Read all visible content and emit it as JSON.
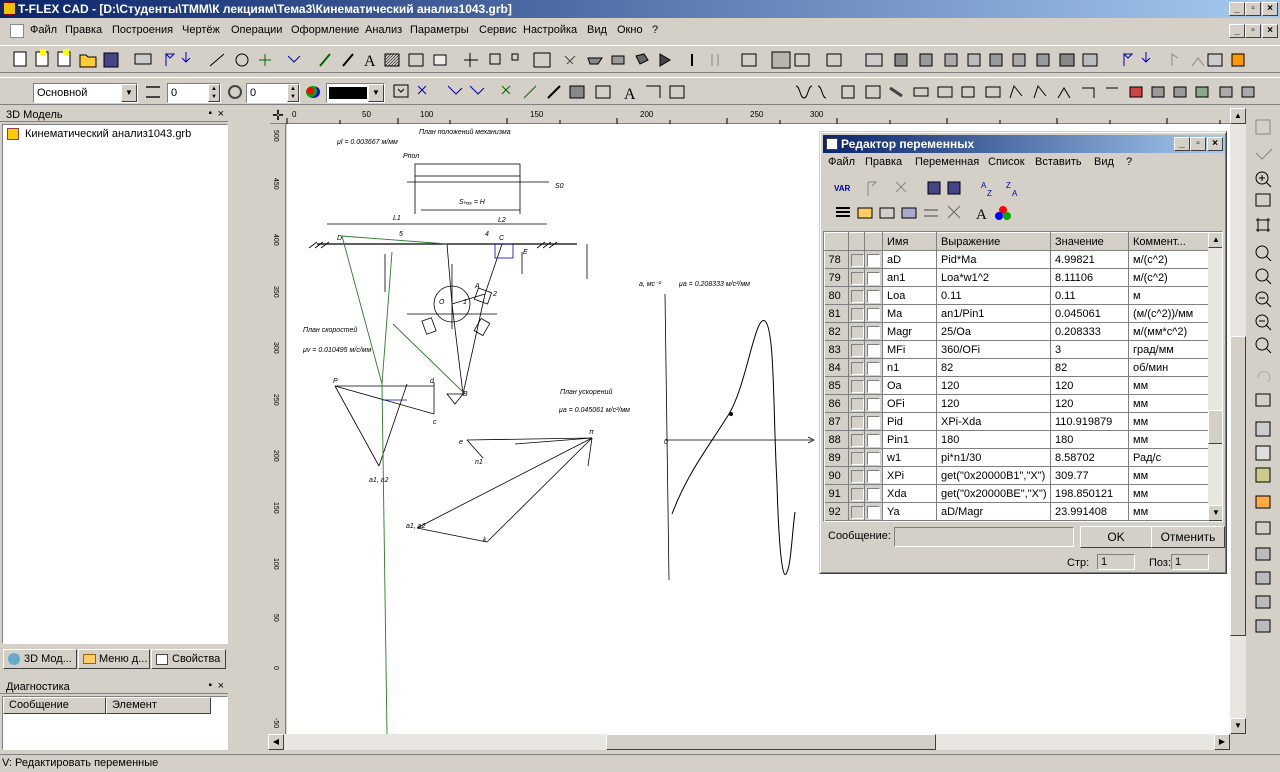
{
  "app": {
    "title": "T-FLEX CAD - [D:\\Студенты\\ТММ\\К лекциям\\Тема3\\Кинематический анализ1043.grb]"
  },
  "menu": [
    "Файл",
    "Правка",
    "Построения",
    "Чертёж",
    "Операции",
    "Оформление",
    "Анализ",
    "Параметры",
    "Сервис",
    "Настройка",
    "Вид",
    "Окно",
    "?"
  ],
  "toolbar2": {
    "layer_value": "Основной",
    "field1_value": "0",
    "field2_value": "0"
  },
  "left_panel": {
    "title": "3D Модель",
    "tree_item": "Кинематический анализ1043.grb",
    "tabs": [
      "3D Мод...",
      "Меню д...",
      "Свойства"
    ]
  },
  "diagnostics": {
    "title": "Диагностика",
    "columns": [
      "Сообщение",
      "Элемент"
    ]
  },
  "drawing": {
    "title": "План положений механизма",
    "mu_l": "μl = 0.003667 м/мм",
    "plan_speed": "План скоростей",
    "mu_v": "μv = 0.010495 м/с/мм",
    "plan_accel": "План ускорений",
    "mu_a": "μa = 0.045061 м/с²/мм",
    "graph_ylabel": "a, мс⁻²",
    "graph_mu": "μa = 0.208333 м/с²/мм",
    "graph_zero": "0",
    "labels": {
      "S_hod": "Sₕₒₐ = H",
      "L1": "L1",
      "L2": "L2",
      "P_pol": "Pпол",
      "S0": "S0",
      "Pv": "P",
      "pi": "π",
      "b": "b",
      "c": "c",
      "d": "d",
      "e": "e",
      "n1": "n1",
      "k": "k",
      "a1a2": "a1, a2",
      "a1a2b": "a1, a2",
      "B": "B",
      "A": "A",
      "C": "C",
      "D": "D",
      "E": "E",
      "O": "O",
      "num5": "5",
      "num4": "4",
      "num2": "2",
      "num1": "1"
    }
  },
  "dialog": {
    "title": "Редактор переменных",
    "menu": [
      "Файл",
      "Правка",
      "Переменная",
      "Список",
      "Вставить",
      "Вид",
      "?"
    ],
    "columns": [
      "Имя",
      "Выражение",
      "Значение",
      "Коммент..."
    ],
    "rows": [
      {
        "n": "78",
        "name": "aD",
        "expr": "Pid*Ma",
        "value": "4.99821",
        "comment": "м/(с^2)"
      },
      {
        "n": "79",
        "name": "an1",
        "expr": "Loa*w1^2",
        "value": "8.11106",
        "comment": "м/(с^2)"
      },
      {
        "n": "80",
        "name": "Loa",
        "expr": "0.11",
        "value": "0.11",
        "comment": "м"
      },
      {
        "n": "81",
        "name": "Ma",
        "expr": "an1/Pin1",
        "value": "0.045061",
        "comment": "(м/(с^2))/мм"
      },
      {
        "n": "82",
        "name": "Magr",
        "expr": "25/Oa",
        "value": "0.208333",
        "comment": "м/(мм*с^2)"
      },
      {
        "n": "83",
        "name": "MFi",
        "expr": "360/OFi",
        "value": "3",
        "comment": "град/мм"
      },
      {
        "n": "84",
        "name": "n1",
        "expr": "82",
        "value": "82",
        "comment": "об/мин"
      },
      {
        "n": "85",
        "name": "Oa",
        "expr": "120",
        "value": "120",
        "comment": "мм"
      },
      {
        "n": "86",
        "name": "OFi",
        "expr": "120",
        "value": "120",
        "comment": "мм"
      },
      {
        "n": "87",
        "name": "Pid",
        "expr": "XPi-Xda",
        "value": "110.919879",
        "comment": "мм"
      },
      {
        "n": "88",
        "name": "Pin1",
        "expr": "180",
        "value": "180",
        "comment": "мм"
      },
      {
        "n": "89",
        "name": "w1",
        "expr": "pi*n1/30",
        "value": "8.58702",
        "comment": "Рад/с"
      },
      {
        "n": "90",
        "name": "XPi",
        "expr": "get(\"0x20000B1\",\"X\")",
        "value": "309.77",
        "comment": "мм"
      },
      {
        "n": "91",
        "name": "Xda",
        "expr": "get(\"0x20000BE\",\"X\")",
        "value": "198.850121",
        "comment": "мм"
      },
      {
        "n": "92",
        "name": "Ya",
        "expr": "aD/Magr",
        "value": "23.991408",
        "comment": "мм"
      }
    ],
    "message_label": "Сообщение:",
    "ok_label": "OK",
    "cancel_label": "Отменить",
    "str_label": "Стр:",
    "str_value": "1",
    "pos_label": "Поз:",
    "pos_value": "1"
  },
  "status": {
    "text": "V: Редактировать переменные"
  }
}
